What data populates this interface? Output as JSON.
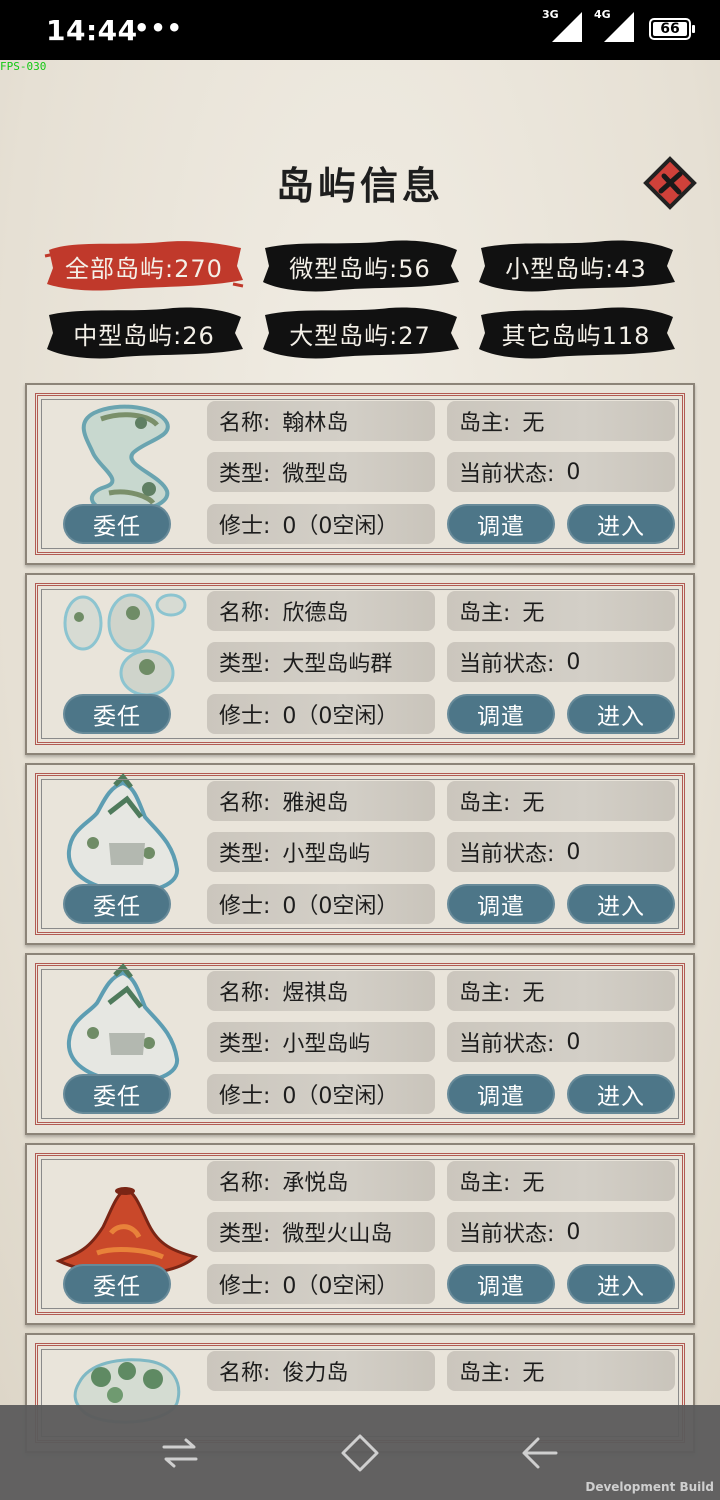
{
  "status_bar": {
    "time": "14:44",
    "more": "•••",
    "signal_1": "3G",
    "signal_2": "4G",
    "battery": "66"
  },
  "debug": {
    "fps": "FPS-030",
    "build": "Development Build"
  },
  "title": "岛屿信息",
  "close_icon": "close-x-icon",
  "tabs": [
    {
      "label": "全部岛屿:270",
      "active": true
    },
    {
      "label": "微型岛屿:56",
      "active": false
    },
    {
      "label": "小型岛屿:43",
      "active": false
    },
    {
      "label": "中型岛屿:26",
      "active": false
    },
    {
      "label": "大型岛屿:27",
      "active": false
    },
    {
      "label": "其它岛屿118",
      "active": false
    }
  ],
  "labels": {
    "name": "名称:",
    "owner": "岛主:",
    "type": "类型:",
    "status": "当前状态:",
    "monk": "修士:",
    "appoint": "委任",
    "dispatch": "调遣",
    "enter": "进入"
  },
  "islands": [
    {
      "name": "翰林岛",
      "owner": "无",
      "type": "微型岛",
      "status": "0",
      "monks": "0（0空闲）",
      "image": "winding-island"
    },
    {
      "name": "欣德岛",
      "owner": "无",
      "type": "大型岛屿群",
      "status": "0",
      "monks": "0（0空闲）",
      "image": "archipelago"
    },
    {
      "name": "雅昶岛",
      "owner": "无",
      "type": "小型岛屿",
      "status": "0",
      "monks": "0（0空闲）",
      "image": "mountain-island"
    },
    {
      "name": "煜祺岛",
      "owner": "无",
      "type": "小型岛屿",
      "status": "0",
      "monks": "0（0空闲）",
      "image": "mountain-island"
    },
    {
      "name": "承悦岛",
      "owner": "无",
      "type": "微型火山岛",
      "status": "0",
      "monks": "0（0空闲）",
      "image": "volcano-island"
    },
    {
      "name": "俊力岛",
      "owner": "无",
      "type": "",
      "status": "",
      "monks": "",
      "image": "forest-island"
    }
  ],
  "colors": {
    "tab_active": "#c0392b",
    "tab_inactive": "#111111",
    "button_teal": "#4d7688",
    "card_border_red": "#b25a52"
  },
  "nav": {
    "back_icon": "back-arrow-icon",
    "home_icon": "home-diamond-icon",
    "recent_icon": "switch-arrows-icon"
  }
}
